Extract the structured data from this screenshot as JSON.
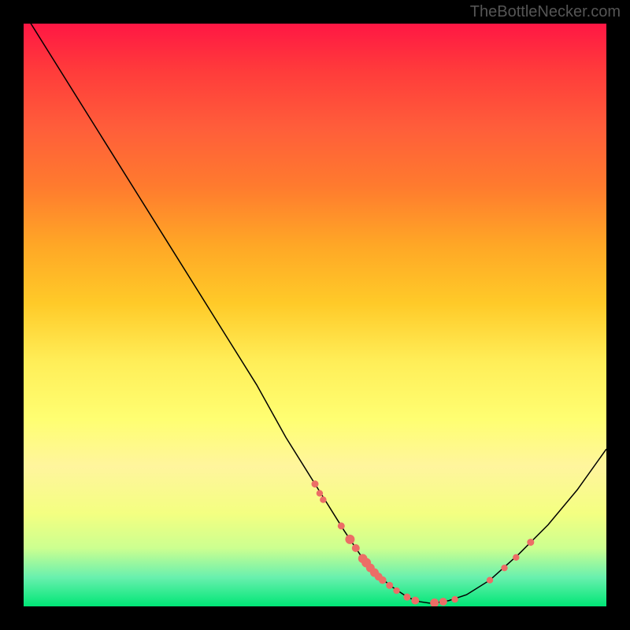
{
  "watermark": "TheBottleNecker.com",
  "chart_data": {
    "type": "line",
    "title": "",
    "xlabel": "",
    "ylabel": "",
    "xlim": [
      0,
      100
    ],
    "ylim": [
      0,
      100
    ],
    "series": [
      {
        "name": "bottleneck-curve",
        "x": [
          0,
          5,
          10,
          15,
          20,
          25,
          30,
          35,
          40,
          45,
          50,
          55,
          58,
          60,
          63,
          66,
          68,
          70,
          73,
          76,
          80,
          85,
          90,
          95,
          100
        ],
        "y": [
          102,
          94,
          86,
          78,
          70,
          62,
          54,
          46,
          38,
          29,
          21,
          13,
          8.5,
          6,
          3.5,
          1.5,
          0.8,
          0.5,
          1,
          2,
          4.5,
          9,
          14,
          20,
          27
        ]
      }
    ],
    "scatter_points": {
      "name": "data-markers",
      "color": "#ec6d66",
      "points": [
        {
          "x": 50.0,
          "y": 21.0,
          "r": 4.5
        },
        {
          "x": 50.8,
          "y": 19.4,
          "r": 4.2
        },
        {
          "x": 51.4,
          "y": 18.3,
          "r": 4.2
        },
        {
          "x": 54.5,
          "y": 13.8,
          "r": 4.5
        },
        {
          "x": 56.0,
          "y": 11.5,
          "r": 6.0
        },
        {
          "x": 57.0,
          "y": 10.0,
          "r": 5.0
        },
        {
          "x": 58.2,
          "y": 8.2,
          "r": 5.8
        },
        {
          "x": 58.8,
          "y": 7.5,
          "r": 6.0
        },
        {
          "x": 59.5,
          "y": 6.6,
          "r": 5.5
        },
        {
          "x": 60.2,
          "y": 5.8,
          "r": 5.5
        },
        {
          "x": 60.9,
          "y": 5.1,
          "r": 5.0
        },
        {
          "x": 61.6,
          "y": 4.5,
          "r": 4.8
        },
        {
          "x": 62.8,
          "y": 3.6,
          "r": 4.5
        },
        {
          "x": 64.0,
          "y": 2.7,
          "r": 4.2
        },
        {
          "x": 65.8,
          "y": 1.6,
          "r": 4.5
        },
        {
          "x": 67.2,
          "y": 1.0,
          "r": 5.0
        },
        {
          "x": 70.5,
          "y": 0.6,
          "r": 5.5
        },
        {
          "x": 72.0,
          "y": 0.8,
          "r": 5.0
        },
        {
          "x": 74.0,
          "y": 1.2,
          "r": 4.2
        },
        {
          "x": 80.0,
          "y": 4.5,
          "r": 4.2
        },
        {
          "x": 82.5,
          "y": 6.6,
          "r": 4.2
        },
        {
          "x": 84.5,
          "y": 8.4,
          "r": 4.2
        },
        {
          "x": 87.0,
          "y": 11.0,
          "r": 4.5
        }
      ]
    }
  }
}
